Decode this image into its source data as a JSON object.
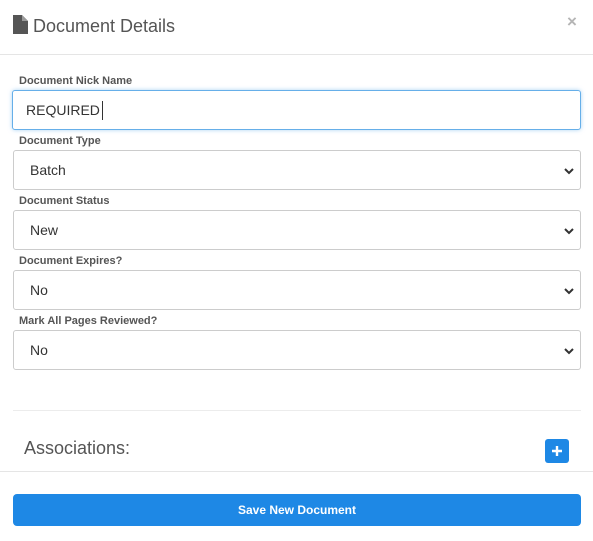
{
  "dialog": {
    "title": "Document Details",
    "close_glyph": "×"
  },
  "form": {
    "nick_name": {
      "label": "Document Nick Name",
      "value": "REQUIRED"
    },
    "type": {
      "label": "Document Type",
      "value": "Batch"
    },
    "status": {
      "label": "Document Status",
      "value": "New"
    },
    "expires": {
      "label": "Document Expires?",
      "value": "No"
    },
    "reviewed": {
      "label": "Mark All Pages Reviewed?",
      "value": "No"
    }
  },
  "associations": {
    "title": "Associations:",
    "add_icon": "plus-icon"
  },
  "footer": {
    "save_label": "Save New Document"
  },
  "colors": {
    "primary": "#1e88e5",
    "focus_border": "#66afe9",
    "text": "#555555"
  },
  "icons": {
    "header": "file-icon",
    "close": "close-icon",
    "select": "chevron-down-icon"
  }
}
